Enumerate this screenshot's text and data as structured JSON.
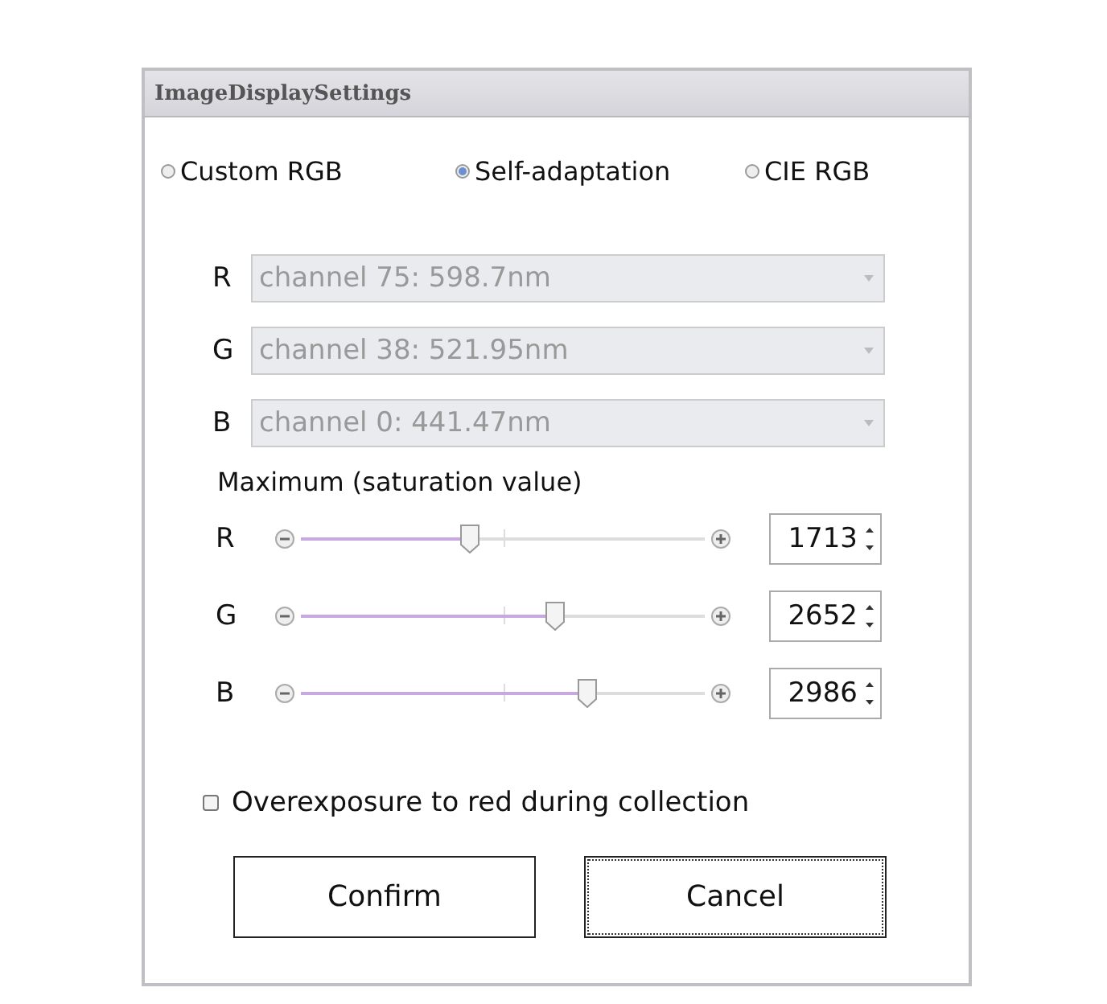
{
  "window": {
    "title": "ImageDisplaySettings"
  },
  "modes": [
    {
      "label": "Custom RGB",
      "selected": false
    },
    {
      "label": "Self-adaptation",
      "selected": true
    },
    {
      "label": "CIE RGB",
      "selected": false
    }
  ],
  "channels": [
    {
      "label": "R",
      "value": "channel 75: 598.7nm",
      "disabled": true
    },
    {
      "label": "G",
      "value": "channel 38: 521.95nm",
      "disabled": true
    },
    {
      "label": "B",
      "value": "channel 0: 441.47nm",
      "disabled": true
    }
  ],
  "maximum": {
    "heading": "Maximum (saturation value)",
    "sliders": [
      {
        "label": "R",
        "level": 0.42,
        "value": "1713"
      },
      {
        "label": "G",
        "level": 0.63,
        "value": "2652"
      },
      {
        "label": "B",
        "level": 0.71,
        "value": "2986"
      }
    ]
  },
  "overexposure": {
    "label": "Overexposure to red during collection",
    "checked": false
  },
  "buttons": [
    {
      "label": "Confirm",
      "focused": false
    },
    {
      "label": "Cancel",
      "focused": true
    }
  ]
}
